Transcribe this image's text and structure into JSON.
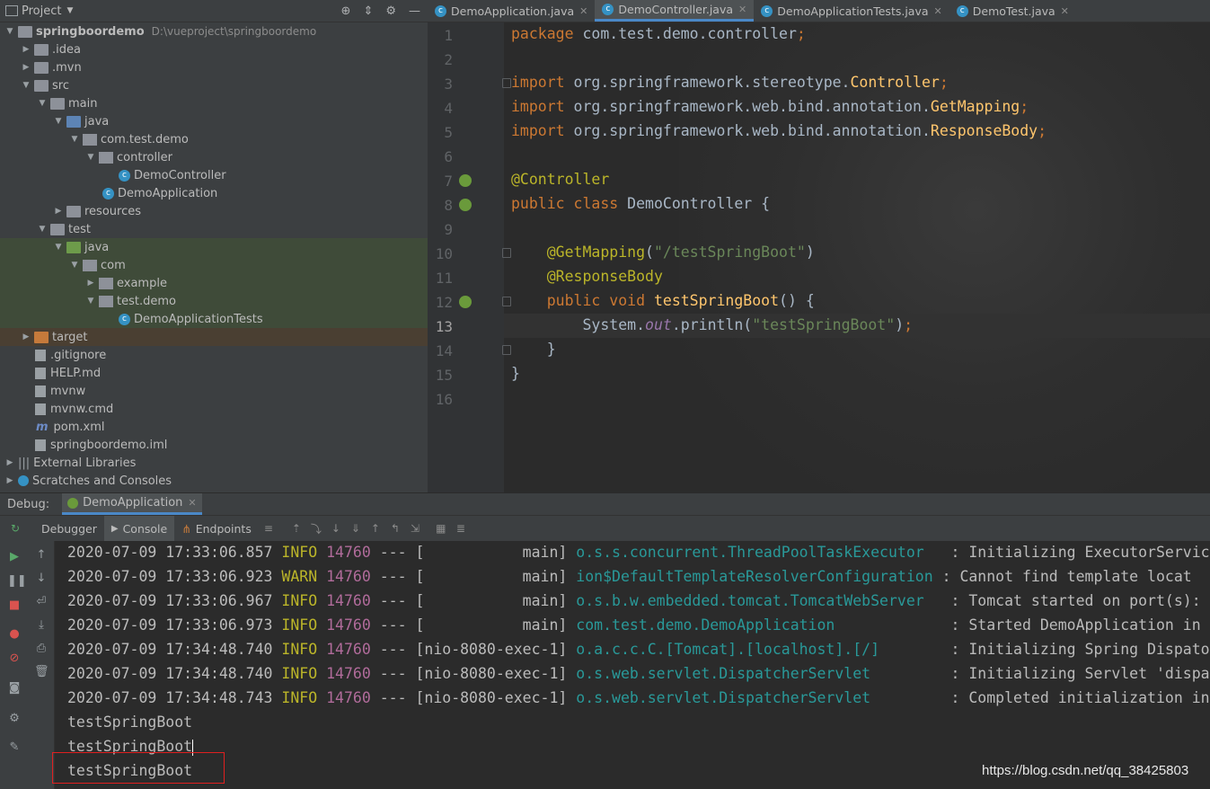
{
  "project_panel": {
    "title": "Project",
    "tree": [
      {
        "label": "springboordemo",
        "path": "D:\\vueproject\\springboordemo"
      },
      {
        "label": ".idea"
      },
      {
        "label": ".mvn"
      },
      {
        "label": "src"
      },
      {
        "label": "main"
      },
      {
        "label": "java"
      },
      {
        "label": "com.test.demo"
      },
      {
        "label": "controller"
      },
      {
        "label": "DemoController"
      },
      {
        "label": "DemoApplication"
      },
      {
        "label": "resources"
      },
      {
        "label": "test"
      },
      {
        "label": "java"
      },
      {
        "label": "com"
      },
      {
        "label": "example"
      },
      {
        "label": "test.demo"
      },
      {
        "label": "DemoApplicationTests"
      },
      {
        "label": "target"
      },
      {
        "label": ".gitignore"
      },
      {
        "label": "HELP.md"
      },
      {
        "label": "mvnw"
      },
      {
        "label": "mvnw.cmd"
      },
      {
        "label": "pom.xml"
      },
      {
        "label": "springboordemo.iml"
      },
      {
        "label": "External Libraries"
      },
      {
        "label": "Scratches and Consoles"
      }
    ]
  },
  "editor_tabs": [
    {
      "label": "DemoApplication.java"
    },
    {
      "label": "DemoController.java"
    },
    {
      "label": "DemoApplicationTests.java"
    },
    {
      "label": "DemoTest.java"
    }
  ],
  "editor": {
    "line_numbers": [
      "1",
      "2",
      "3",
      "4",
      "5",
      "6",
      "7",
      "8",
      "9",
      "10",
      "11",
      "12",
      "13",
      "14",
      "15",
      "16"
    ],
    "code": {
      "l1a": "package",
      "l1b": " com.test.demo.controller",
      "l1c": ";",
      "l3a": "import",
      "l3b": " org.springframework.stereotype.",
      "l3c": "Controller",
      "l3d": ";",
      "l4a": "import",
      "l4b": " org.springframework.web.bind.annotation.",
      "l4c": "GetMapping",
      "l4d": ";",
      "l5a": "import",
      "l5b": " org.springframework.web.bind.annotation.",
      "l5c": "ResponseBody",
      "l5d": ";",
      "l7": "@Controller",
      "l8a": "public class",
      "l8b": " DemoController {",
      "l10a": "    @GetMapping",
      "l10b": "(",
      "l10c": "\"/testSpringBoot\"",
      "l10d": ")",
      "l11": "    @ResponseBody",
      "l12a": "    public void",
      "l12b": " testSpringBoot",
      "l12c": "() {",
      "l13a": "        System.",
      "l13b": "out",
      "l13c": ".println(",
      "l13d": "\"testSpringBoot\"",
      "l13e": ")",
      "l13f": ";",
      "l14": "    }",
      "l15": "}"
    }
  },
  "debug": {
    "label": "Debug:",
    "session_tab": "DemoApplication",
    "toolbar": {
      "debugger": "Debugger",
      "console": "Console",
      "endpoints": "Endpoints"
    },
    "console_lines": [
      {
        "ts": "2020-07-09 17:33:06.857",
        "level": "INFO",
        "pid": "14760",
        "sep": " --- ",
        "thread": "[           main]",
        "logger": "o.s.s.concurrent.ThreadPoolTaskExecutor ",
        "msg": "  : Initializing ExecutorServic"
      },
      {
        "ts": "2020-07-09 17:33:06.923",
        "level": "WARN",
        "pid": "14760",
        "sep": " --- ",
        "thread": "[           main]",
        "logger": "ion$DefaultTemplateResolverConfiguration",
        "msg": " : Cannot find template locat"
      },
      {
        "ts": "2020-07-09 17:33:06.967",
        "level": "INFO",
        "pid": "14760",
        "sep": " --- ",
        "thread": "[           main]",
        "logger": "o.s.b.w.embedded.tomcat.TomcatWebServer ",
        "msg": "  : Tomcat started on port(s):"
      },
      {
        "ts": "2020-07-09 17:33:06.973",
        "level": "INFO",
        "pid": "14760",
        "sep": " --- ",
        "thread": "[           main]",
        "logger": "com.test.demo.DemoApplication           ",
        "msg": "  : Started DemoApplication in"
      },
      {
        "ts": "2020-07-09 17:34:48.740",
        "level": "INFO",
        "pid": "14760",
        "sep": " --- ",
        "thread": "[nio-8080-exec-1]",
        "logger": "o.a.c.c.C.[Tomcat].[localhost].[/]      ",
        "msg": "  : Initializing Spring Dispato"
      },
      {
        "ts": "2020-07-09 17:34:48.740",
        "level": "INFO",
        "pid": "14760",
        "sep": " --- ",
        "thread": "[nio-8080-exec-1]",
        "logger": "o.s.web.servlet.DispatcherServlet       ",
        "msg": "  : Initializing Servlet 'dispa"
      },
      {
        "ts": "2020-07-09 17:34:48.743",
        "level": "INFO",
        "pid": "14760",
        "sep": " --- ",
        "thread": "[nio-8080-exec-1]",
        "logger": "o.s.web.servlet.DispatcherServlet       ",
        "msg": "  : Completed initialization in"
      }
    ],
    "output_lines": [
      "testSpringBoot",
      "testSpringBoot",
      "testSpringBoot"
    ]
  },
  "watermark": "https://blog.csdn.net/qq_38425803"
}
